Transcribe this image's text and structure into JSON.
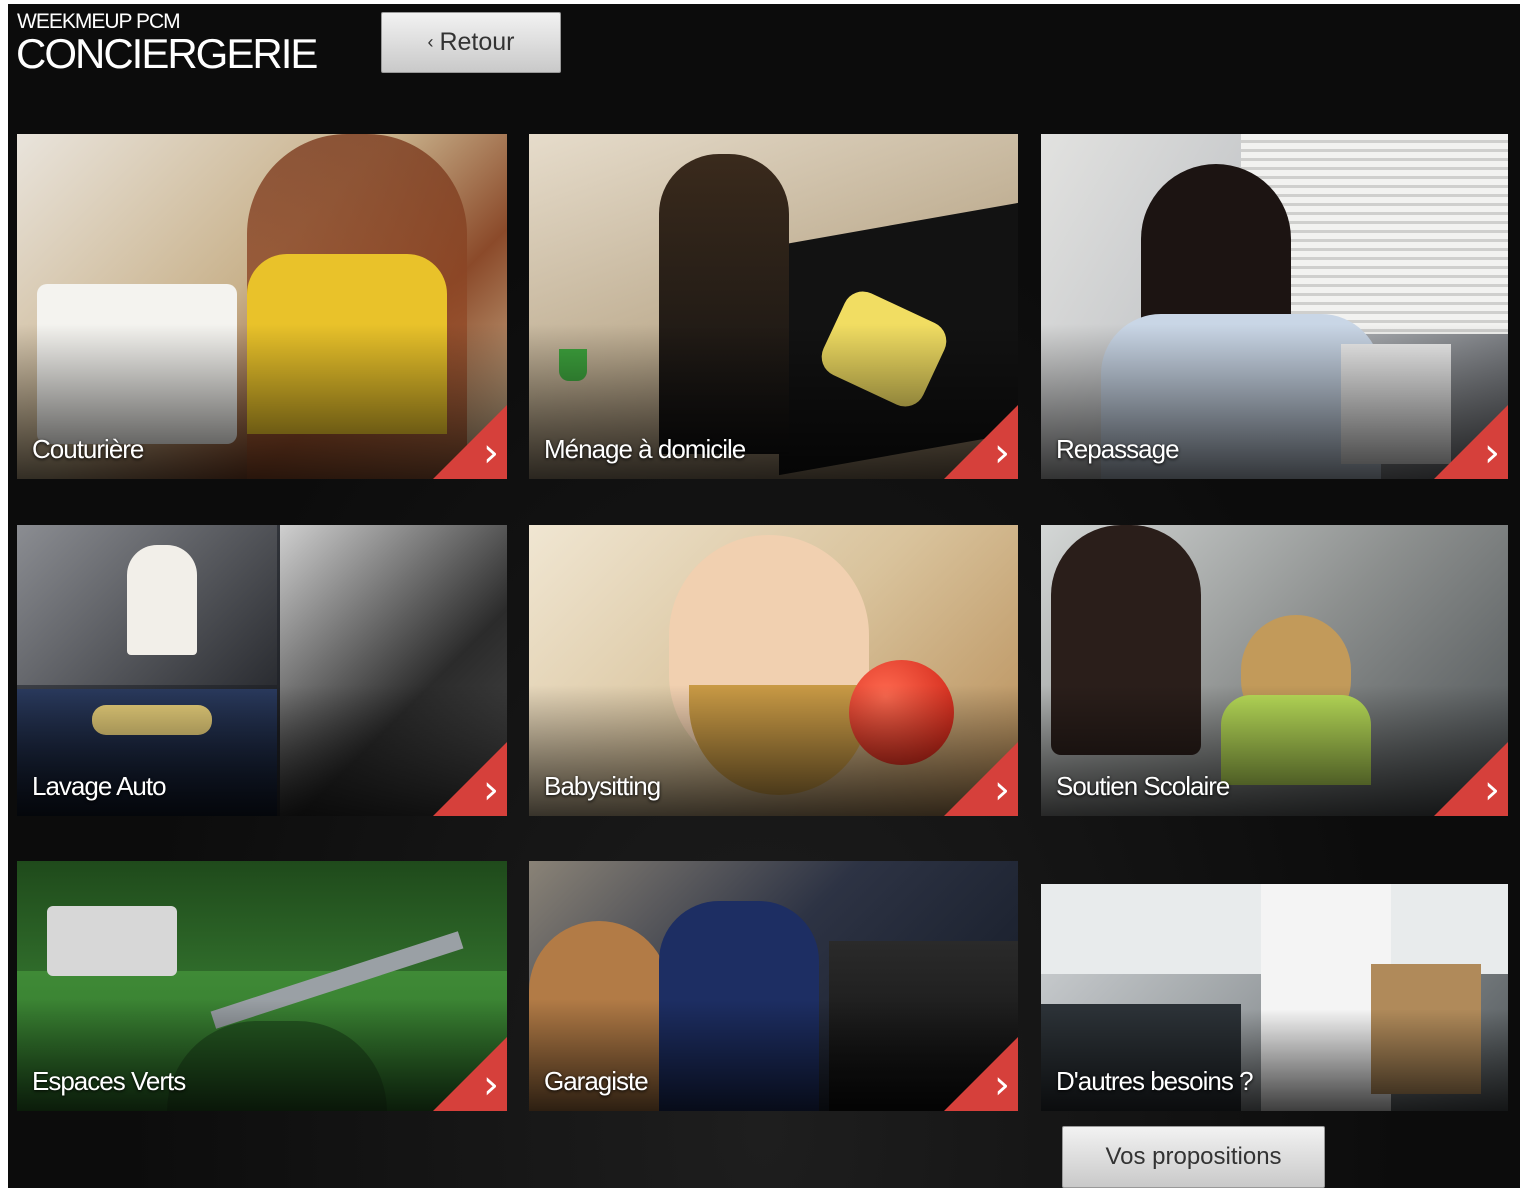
{
  "header": {
    "brand_sub": "WEEKMEUP PCM",
    "brand_title": "CONCIERGERIE",
    "back_chevron": "‹",
    "back_label": "Retour"
  },
  "tiles": [
    {
      "label": "Couturière",
      "has_arrow": true
    },
    {
      "label": "Ménage à domicile",
      "has_arrow": true
    },
    {
      "label": "Repassage",
      "has_arrow": true
    },
    {
      "label": "Lavage Auto",
      "has_arrow": true
    },
    {
      "label": "Babysitting",
      "has_arrow": true
    },
    {
      "label": "Soutien Scolaire",
      "has_arrow": true
    },
    {
      "label": "Espaces Verts",
      "has_arrow": true
    },
    {
      "label": "Garagiste",
      "has_arrow": true
    },
    {
      "label": "D'autres besoins ?",
      "has_arrow": false
    }
  ],
  "arrow_glyph": "›",
  "footer": {
    "propositions_label": "Vos propositions"
  },
  "colors": {
    "background": "#0c0c0c",
    "corner_accent": "#d6403b",
    "button_top": "#f2f2f2",
    "button_bottom": "#c9c9c9"
  }
}
